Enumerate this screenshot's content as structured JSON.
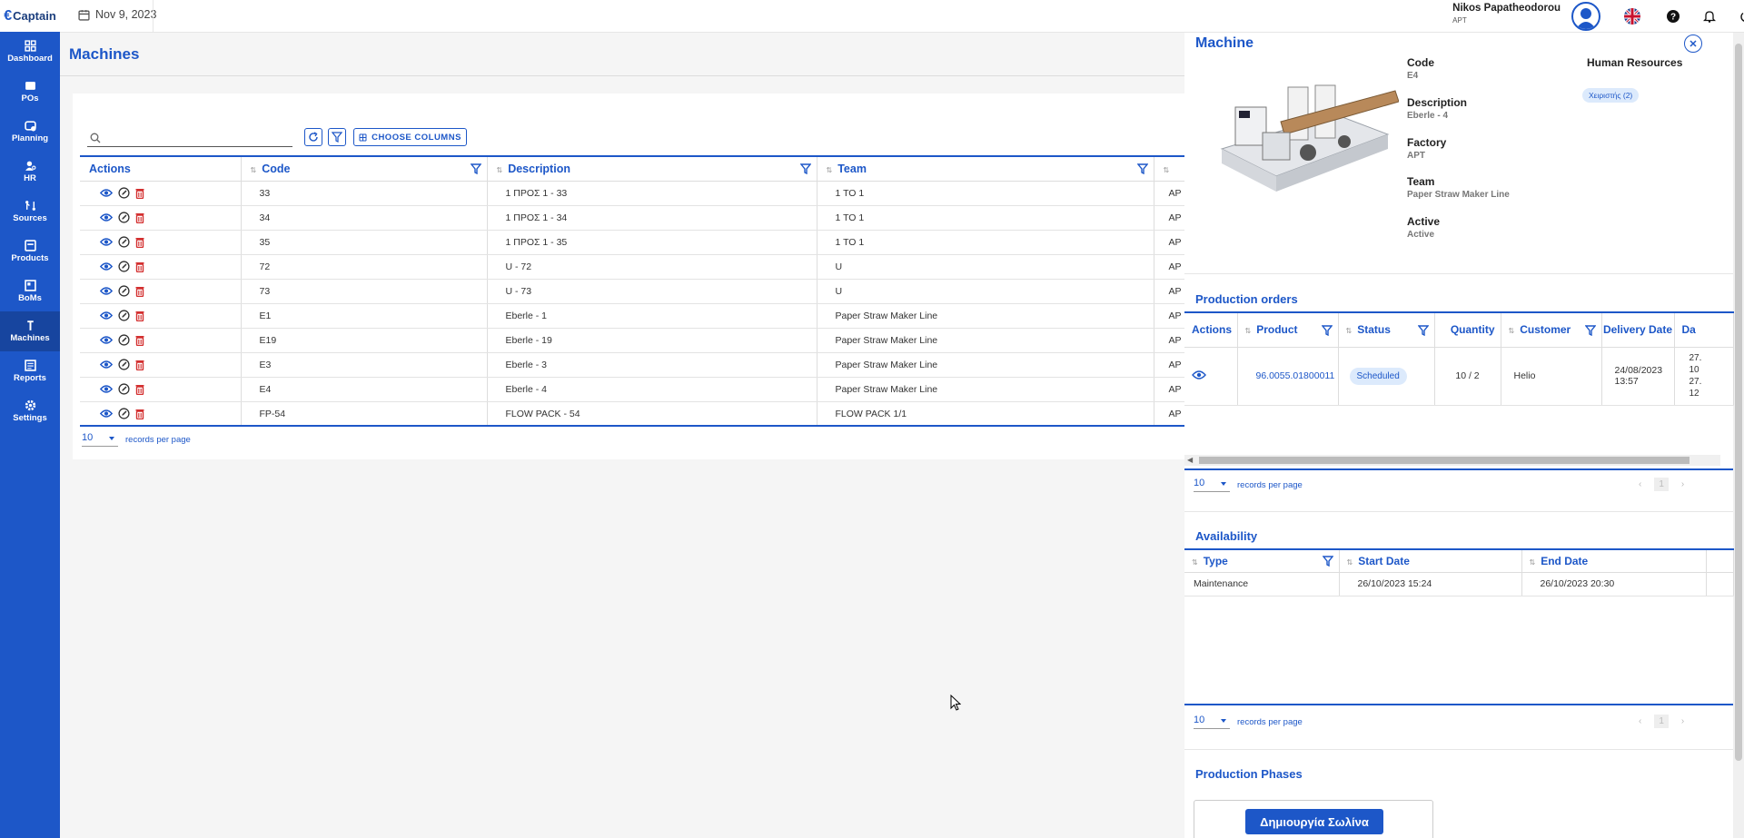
{
  "app": {
    "name": "Captain"
  },
  "sidebar": {
    "items": [
      {
        "label": "Dashboard",
        "icon": "dashboard-icon"
      },
      {
        "label": "POs",
        "icon": "po-icon"
      },
      {
        "label": "Planning",
        "icon": "planning-icon"
      },
      {
        "label": "HR",
        "icon": "hr-icon"
      },
      {
        "label": "Sources",
        "icon": "sources-icon"
      },
      {
        "label": "Products",
        "icon": "products-icon"
      },
      {
        "label": "BoMs",
        "icon": "boms-icon"
      },
      {
        "label": "Machines",
        "icon": "machines-icon",
        "active": true
      },
      {
        "label": "Reports",
        "icon": "reports-icon"
      },
      {
        "label": "Settings",
        "icon": "settings-icon"
      }
    ]
  },
  "topbar": {
    "date": "Nov 9, 2023",
    "user_name": "Nikos Papatheodorou",
    "user_sub": "APT"
  },
  "page": {
    "title": "Machines"
  },
  "toolbar": {
    "search_placeholder": "",
    "choose_columns_label": "CHOOSE COLUMNS"
  },
  "grid": {
    "columns": [
      "Actions",
      "Code",
      "Description",
      "Team"
    ],
    "rows": [
      {
        "code": "33",
        "description": "1 ΠΡΟΣ 1 - 33",
        "team": "1 TO 1",
        "factory": "AP"
      },
      {
        "code": "34",
        "description": "1 ΠΡΟΣ 1 - 34",
        "team": "1 TO 1",
        "factory": "AP"
      },
      {
        "code": "35",
        "description": "1 ΠΡΟΣ 1 - 35",
        "team": "1 TO 1",
        "factory": "AP"
      },
      {
        "code": "72",
        "description": "U - 72",
        "team": "U",
        "factory": "AP"
      },
      {
        "code": "73",
        "description": "U - 73",
        "team": "U",
        "factory": "AP"
      },
      {
        "code": "E1",
        "description": "Eberle - 1",
        "team": "Paper Straw Maker Line",
        "factory": "AP"
      },
      {
        "code": "E19",
        "description": "Eberle - 19",
        "team": "Paper Straw Maker Line",
        "factory": "AP"
      },
      {
        "code": "E3",
        "description": "Eberle - 3",
        "team": "Paper Straw Maker Line",
        "factory": "AP"
      },
      {
        "code": "E4",
        "description": "Eberle - 4",
        "team": "Paper Straw Maker Line",
        "factory": "AP"
      },
      {
        "code": "FP-54",
        "description": "FLOW PACK - 54",
        "team": "FLOW PACK 1/1",
        "factory": "AP"
      }
    ],
    "page_size": "10",
    "records_label": "records per page"
  },
  "panel": {
    "title": "Machine",
    "fields": {
      "code_label": "Code",
      "code": "E4",
      "description_label": "Description",
      "description": "Eberle - 4",
      "factory_label": "Factory",
      "factory": "APT",
      "team_label": "Team",
      "team": "Paper Straw Maker Line",
      "active_label": "Active",
      "active": "Active",
      "hr_label": "Human Resources",
      "hr_chip": "Χειριστής (2)"
    },
    "production_orders": {
      "title": "Production orders",
      "columns": {
        "actions": "Actions",
        "product": "Product",
        "status": "Status",
        "quantity": "Quantity",
        "customer": "Customer",
        "delivery": "Delivery Date",
        "da": "Da"
      },
      "row": {
        "product": "96.0055.01800011",
        "status": "Scheduled",
        "quantity": "10 / 2",
        "customer": "Helio",
        "delivery": "24/08/2023 13:57",
        "da1": "27.",
        "da2": "10",
        "da3": "27.",
        "da4": "12"
      },
      "page_size": "10",
      "records_label": "records per page",
      "page": "1"
    },
    "availability": {
      "title": "Availability",
      "columns": {
        "type": "Type",
        "start": "Start Date",
        "end": "End Date"
      },
      "row": {
        "type": "Maintenance",
        "start": "26/10/2023 15:24",
        "end": "26/10/2023 20:30"
      },
      "page_size": "10",
      "records_label": "records per page",
      "page": "1"
    },
    "phases": {
      "title": "Production Phases",
      "button": "Δημιουργία Σωλίνα"
    }
  },
  "colors": {
    "primary": "#1d57c8",
    "danger": "#d32f2f"
  }
}
